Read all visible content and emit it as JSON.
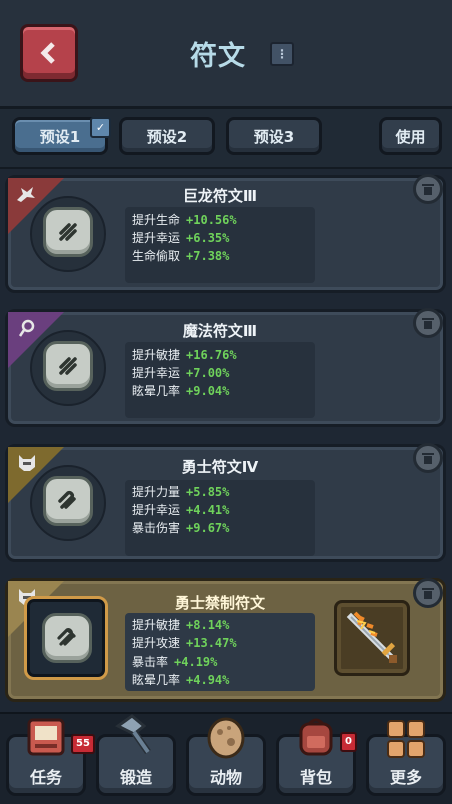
{
  "header": {
    "title": "符文",
    "info_icon": "info-icon",
    "back_icon": "chevron-left-icon"
  },
  "presets": {
    "items": [
      {
        "label": "预设1",
        "active": true
      },
      {
        "label": "预设2",
        "active": false
      },
      {
        "label": "预设3",
        "active": false
      }
    ],
    "use_label": "使用",
    "check_icon": "checkmark-icon"
  },
  "runes": [
    {
      "name": "巨龙符文Ⅲ",
      "corner_color": "#8a3a3a",
      "corner_icon": "dragon-icon",
      "stats": [
        {
          "label": "提升生命",
          "value": "+10.56%"
        },
        {
          "label": "提升幸运",
          "value": "+6.35%"
        },
        {
          "label": "生命偷取",
          "value": "+7.38%"
        }
      ]
    },
    {
      "name": "魔法符文Ⅲ",
      "corner_color": "#6a3f7e",
      "corner_icon": "magic-icon",
      "stats": [
        {
          "label": "提升敏捷",
          "value": "+16.76%"
        },
        {
          "label": "提升幸运",
          "value": "+7.00%"
        },
        {
          "label": "眩晕几率",
          "value": "+9.04%"
        }
      ]
    },
    {
      "name": "勇士符文Ⅳ",
      "corner_color": "#7e6a2e",
      "corner_icon": "helmet-icon",
      "stats": [
        {
          "label": "提升力量",
          "value": "+5.85%"
        },
        {
          "label": "提升幸运",
          "value": "+4.41%"
        },
        {
          "label": "暴击伤害",
          "value": "+9.67%"
        }
      ]
    },
    {
      "name": "勇士禁制符文",
      "corner_color": "#9a8550",
      "corner_icon": "helmet-icon",
      "stats": [
        {
          "label": "提升敏捷",
          "value": "+8.14%"
        },
        {
          "label": "提升攻速",
          "value": "+13.47%"
        },
        {
          "label": "暴击率",
          "value": "+4.19%"
        },
        {
          "label": "眩晕几率",
          "value": "+4.94%"
        }
      ],
      "equipped_item_icon": "flame-sword-icon"
    }
  ],
  "bottom_nav": [
    {
      "label": "任务",
      "icon": "quest-book-icon",
      "badge": "55"
    },
    {
      "label": "锻造",
      "icon": "hammer-icon",
      "badge": null
    },
    {
      "label": "动物",
      "icon": "egg-icon",
      "badge": null
    },
    {
      "label": "背包",
      "icon": "backpack-icon",
      "badge": "0"
    },
    {
      "label": "更多",
      "icon": "grid-icon",
      "badge": null
    }
  ]
}
